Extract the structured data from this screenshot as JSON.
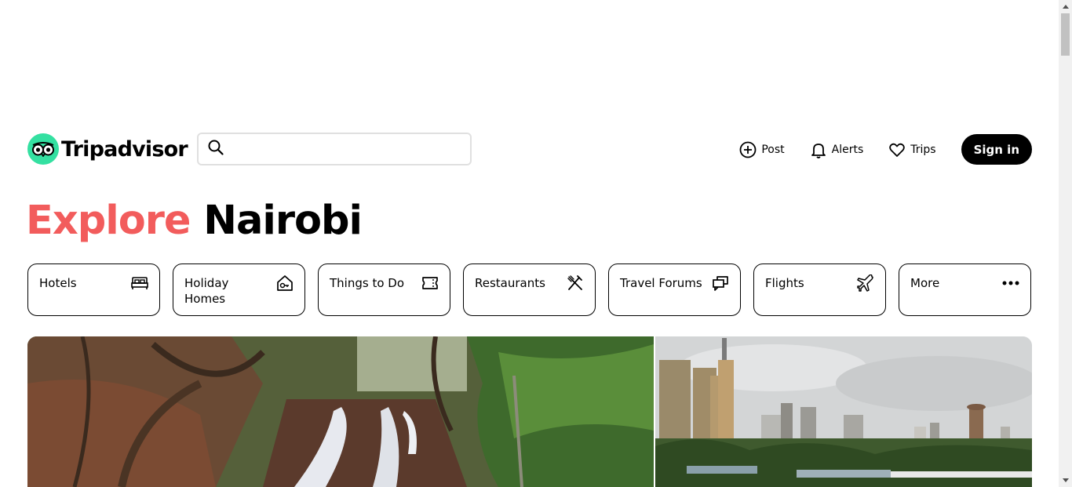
{
  "brand": {
    "name": "Tripadvisor",
    "accent_color": "#34e0a1"
  },
  "search": {
    "placeholder": "",
    "value": ""
  },
  "nav": {
    "post_label": "Post",
    "alerts_label": "Alerts",
    "trips_label": "Trips",
    "signin_label": "Sign in"
  },
  "title": {
    "prefix": "Explore",
    "place": "Nairobi",
    "prefix_color": "#f25c5c"
  },
  "categories": [
    {
      "label": "Hotels",
      "icon": "bed-icon"
    },
    {
      "label": "Holiday Homes",
      "icon": "house-key-icon"
    },
    {
      "label": "Things to Do",
      "icon": "ticket-icon"
    },
    {
      "label": "Restaurants",
      "icon": "fork-knife-icon"
    },
    {
      "label": "Travel Forums",
      "icon": "chat-bubbles-icon"
    },
    {
      "label": "Flights",
      "icon": "airplane-icon"
    },
    {
      "label": "More",
      "icon": "more-dots-icon"
    }
  ],
  "hero": {
    "images": [
      {
        "name": "waterfall-forest-photo"
      },
      {
        "name": "nairobi-skyline-photo"
      }
    ]
  }
}
